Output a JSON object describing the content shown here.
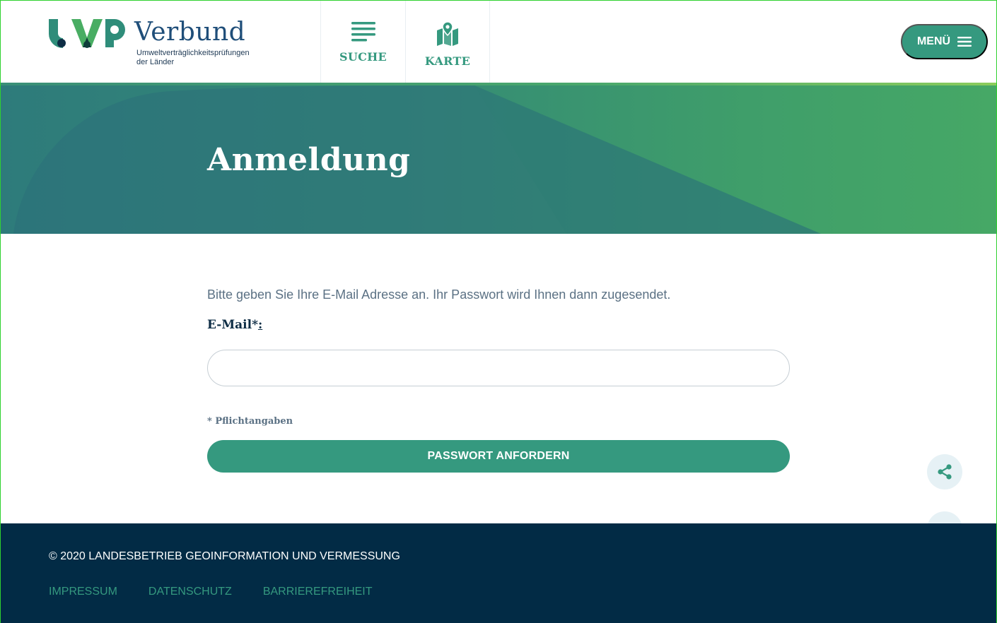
{
  "header": {
    "logo": {
      "mark": "UVP",
      "title": "Verbund",
      "subtitle_line1": "Umweltverträglichkeitsprüfungen",
      "subtitle_line2": "der Länder"
    },
    "nav": [
      {
        "label": "SUCHE",
        "icon": "list-icon"
      },
      {
        "label": "KARTE",
        "icon": "map-pin-icon"
      }
    ],
    "menu_label": "MENÜ",
    "menu_icon": "hamburger-icon"
  },
  "hero": {
    "title": "Anmeldung"
  },
  "form": {
    "intro": "Bitte geben Sie Ihre E-Mail Adresse an. Ihr Passwort wird Ihnen dann zugesendet.",
    "email_label": "E-Mail*",
    "email_label_suffix": ":",
    "email_value": "",
    "email_placeholder": "",
    "required_note": "* Pflichtangaben",
    "submit_label": "PASSWORT ANFORDERN"
  },
  "floating": {
    "share_icon": "share-icon",
    "top_icon": "chevron-up-icon"
  },
  "footer": {
    "copyright": "© 2020 LANDESBETRIEB GEOINFORMATION UND VERMESSUNG",
    "links": [
      "IMPRESSUM",
      "DATENSCHUTZ",
      "BARRIEREFREIHEIT"
    ]
  },
  "colors": {
    "accent": "#35997f",
    "footer_bg": "#022b45",
    "heading_dark": "#0e2d45",
    "logo_blue": "#1f4e79"
  }
}
